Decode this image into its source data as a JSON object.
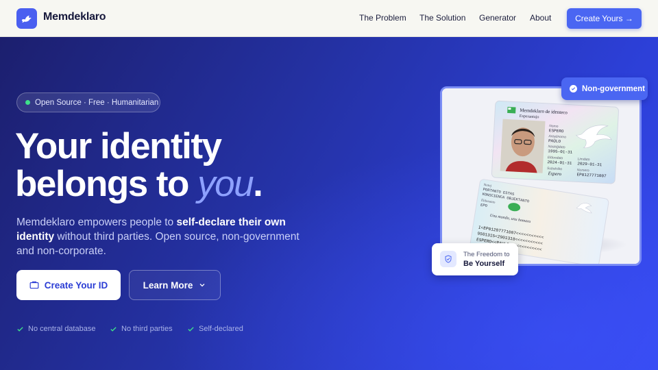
{
  "nav": {
    "brand": "Memdeklaro",
    "links": [
      "The Problem",
      "The Solution",
      "Generator",
      "About"
    ],
    "cta": "Create Yours →"
  },
  "hero": {
    "badge": "Open Source · Free · Humanitarian",
    "title_line1": "Your identity",
    "title_line2_prefix": "belongs to ",
    "title_line2_accent": "you",
    "title_line2_suffix": ".",
    "lead_1": "Memdeklaro empowers people to ",
    "lead_bold": "self-declare their own identity",
    "lead_2": " without third parties. Open source, non-government and non-corporate.",
    "primary_button": "Create Your ID",
    "secondary_button": "Learn More",
    "checks": [
      "No central database",
      "No third parties",
      "Self-declared"
    ]
  },
  "card_preview": {
    "tag": "Non-government",
    "freedom_line1": "The Freedom to",
    "freedom_line2": "Be Yourself",
    "front": {
      "header1": "Memdeklaro de identeco",
      "header2": "Esperantujo",
      "name_label": "Nomo",
      "name_value": "ESPERO",
      "given_label": "Antaŭnomo",
      "given_value": "PAŬLO",
      "birth_label": "Naskiĝdato",
      "birth_value": "1995-01-31",
      "issue_label": "Eldondato",
      "issue_value": "2024-01-31",
      "expiry_label": "Limdato",
      "expiry_value": "2029-01-31",
      "sign_label": "Subskribo",
      "sign_value": "Espero",
      "number_label": "Numero",
      "number_value": "EP0127771007"
    },
    "back": {
      "note_label": "Notoj",
      "note_value": "PORTANTO ESTAS KONSCIENCA OBJEKTANTO",
      "issuer_label": "Eldonanto",
      "issuer_value": "EPO",
      "motto": "Unu mondo, unu homaro",
      "mrz1": "I<EP01207771007<<<<<<<<<<<",
      "mrz2": "9501315<2901318<<<<<<<<<<<",
      "mrz3": "ESPERO<<PAULO<<<<<<<<<<<<<"
    }
  },
  "colors": {
    "primary": "#4a66f2",
    "hero_dark": "#1c1f6e",
    "hero_light": "#3548ee",
    "accent_text": "#8ea1ff",
    "badge_dot": "#3ee08a"
  }
}
